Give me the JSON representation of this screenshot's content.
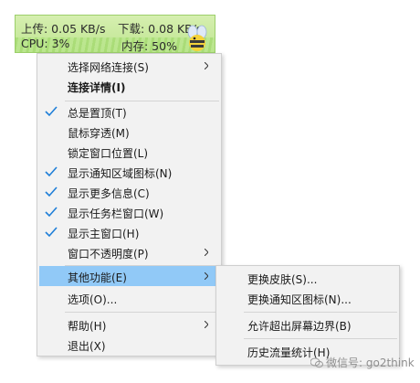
{
  "widget": {
    "upload": "上传: 0.05 KB/s",
    "download": "下载: 0.08 KB/s",
    "cpu": "CPU: 3%",
    "memory": "内存: 50%"
  },
  "menu": {
    "items": [
      {
        "label": "选择网络连接(S)",
        "checked": false,
        "submenu": true
      },
      {
        "label": "连接详情(I)",
        "checked": false,
        "bold": true
      },
      {
        "label": "总是置顶(T)",
        "checked": true
      },
      {
        "label": "鼠标穿透(M)",
        "checked": false
      },
      {
        "label": "锁定窗口位置(L)",
        "checked": false
      },
      {
        "label": "显示通知区域图标(N)",
        "checked": true
      },
      {
        "label": "显示更多信息(C)",
        "checked": true
      },
      {
        "label": "显示任务栏窗口(W)",
        "checked": true
      },
      {
        "label": "显示主窗口(H)",
        "checked": true
      },
      {
        "label": "窗口不透明度(P)",
        "checked": false,
        "submenu": true
      },
      {
        "label": "其他功能(E)",
        "checked": false,
        "submenu": true,
        "highlighted": true
      },
      {
        "label": "选项(O)...",
        "checked": false
      },
      {
        "label": "帮助(H)",
        "checked": false,
        "submenu": true
      },
      {
        "label": "退出(X)",
        "checked": false
      }
    ]
  },
  "submenu": {
    "items": [
      {
        "label": "更换皮肤(S)..."
      },
      {
        "label": "更换通知区图标(N)..."
      },
      {
        "label": "允许超出屏幕边界(B)"
      },
      {
        "label": "历史流量统计(H)"
      }
    ]
  },
  "watermark": {
    "text": "微信号: go2think"
  },
  "colors": {
    "highlight": "#91c9f7",
    "check": "#1f7fd8",
    "menu_bg": "#f2f2f2",
    "widget_bg": "#c8eaa0"
  }
}
